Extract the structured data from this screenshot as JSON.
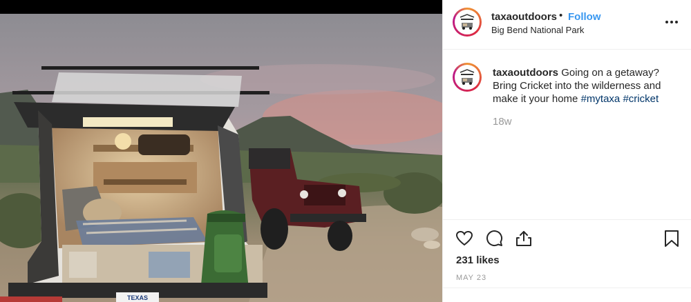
{
  "post": {
    "username": "taxaoutdoors",
    "follow_label": "Follow",
    "separator": "•",
    "location": "Big Bend National Park",
    "caption": {
      "username": "taxaoutdoors",
      "text_line1": "Going on a getaway?",
      "text_line2": "Bring Cricket into the wilderness and",
      "text_line3": "make it your home",
      "hashtags": [
        "#mytaxa",
        "#cricket"
      ]
    },
    "timestamp": "18w",
    "likes": "231 likes",
    "date": "MAY 23",
    "license_plate": "TEXAS"
  },
  "icons": {
    "more": "more-options-icon",
    "like": "heart-icon",
    "comment": "comment-icon",
    "share": "share-icon",
    "save": "bookmark-icon"
  },
  "colors": {
    "follow": "#3897f0",
    "hashtag": "#003569",
    "muted": "#999999",
    "text": "#262626"
  }
}
